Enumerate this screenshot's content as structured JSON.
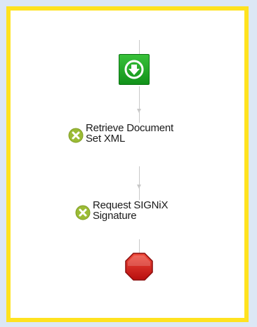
{
  "workflow": {
    "start_node": {
      "icon": "down-arrow-circle-icon"
    },
    "activities": [
      {
        "label": "Retrieve Document\nSet XML",
        "status_icon": "error-x-circle-icon"
      },
      {
        "label": "Request SIGNiX\nSignature",
        "status_icon": "error-x-circle-icon"
      }
    ],
    "end_node": {
      "icon": "stop-octagon-icon"
    }
  },
  "colors": {
    "frame_border": "#ffe21f",
    "start_green": "#12921a",
    "status_green": "#9bbb35",
    "stop_red": "#d81e1e",
    "connector_gray": "#c8c8c8"
  }
}
